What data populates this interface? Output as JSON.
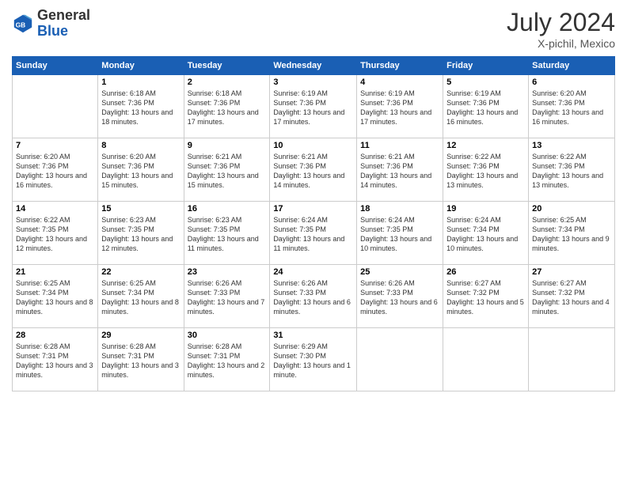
{
  "header": {
    "logo_general": "General",
    "logo_blue": "Blue",
    "month_year": "July 2024",
    "location": "X-pichil, Mexico"
  },
  "days_of_week": [
    "Sunday",
    "Monday",
    "Tuesday",
    "Wednesday",
    "Thursday",
    "Friday",
    "Saturday"
  ],
  "weeks": [
    [
      {
        "day": "",
        "empty": true
      },
      {
        "day": "1",
        "sunrise": "Sunrise: 6:18 AM",
        "sunset": "Sunset: 7:36 PM",
        "daylight": "Daylight: 13 hours and 18 minutes."
      },
      {
        "day": "2",
        "sunrise": "Sunrise: 6:18 AM",
        "sunset": "Sunset: 7:36 PM",
        "daylight": "Daylight: 13 hours and 17 minutes."
      },
      {
        "day": "3",
        "sunrise": "Sunrise: 6:19 AM",
        "sunset": "Sunset: 7:36 PM",
        "daylight": "Daylight: 13 hours and 17 minutes."
      },
      {
        "day": "4",
        "sunrise": "Sunrise: 6:19 AM",
        "sunset": "Sunset: 7:36 PM",
        "daylight": "Daylight: 13 hours and 17 minutes."
      },
      {
        "day": "5",
        "sunrise": "Sunrise: 6:19 AM",
        "sunset": "Sunset: 7:36 PM",
        "daylight": "Daylight: 13 hours and 16 minutes."
      },
      {
        "day": "6",
        "sunrise": "Sunrise: 6:20 AM",
        "sunset": "Sunset: 7:36 PM",
        "daylight": "Daylight: 13 hours and 16 minutes."
      }
    ],
    [
      {
        "day": "7",
        "sunrise": "Sunrise: 6:20 AM",
        "sunset": "Sunset: 7:36 PM",
        "daylight": "Daylight: 13 hours and 16 minutes."
      },
      {
        "day": "8",
        "sunrise": "Sunrise: 6:20 AM",
        "sunset": "Sunset: 7:36 PM",
        "daylight": "Daylight: 13 hours and 15 minutes."
      },
      {
        "day": "9",
        "sunrise": "Sunrise: 6:21 AM",
        "sunset": "Sunset: 7:36 PM",
        "daylight": "Daylight: 13 hours and 15 minutes."
      },
      {
        "day": "10",
        "sunrise": "Sunrise: 6:21 AM",
        "sunset": "Sunset: 7:36 PM",
        "daylight": "Daylight: 13 hours and 14 minutes."
      },
      {
        "day": "11",
        "sunrise": "Sunrise: 6:21 AM",
        "sunset": "Sunset: 7:36 PM",
        "daylight": "Daylight: 13 hours and 14 minutes."
      },
      {
        "day": "12",
        "sunrise": "Sunrise: 6:22 AM",
        "sunset": "Sunset: 7:36 PM",
        "daylight": "Daylight: 13 hours and 13 minutes."
      },
      {
        "day": "13",
        "sunrise": "Sunrise: 6:22 AM",
        "sunset": "Sunset: 7:36 PM",
        "daylight": "Daylight: 13 hours and 13 minutes."
      }
    ],
    [
      {
        "day": "14",
        "sunrise": "Sunrise: 6:22 AM",
        "sunset": "Sunset: 7:35 PM",
        "daylight": "Daylight: 13 hours and 12 minutes."
      },
      {
        "day": "15",
        "sunrise": "Sunrise: 6:23 AM",
        "sunset": "Sunset: 7:35 PM",
        "daylight": "Daylight: 13 hours and 12 minutes."
      },
      {
        "day": "16",
        "sunrise": "Sunrise: 6:23 AM",
        "sunset": "Sunset: 7:35 PM",
        "daylight": "Daylight: 13 hours and 11 minutes."
      },
      {
        "day": "17",
        "sunrise": "Sunrise: 6:24 AM",
        "sunset": "Sunset: 7:35 PM",
        "daylight": "Daylight: 13 hours and 11 minutes."
      },
      {
        "day": "18",
        "sunrise": "Sunrise: 6:24 AM",
        "sunset": "Sunset: 7:35 PM",
        "daylight": "Daylight: 13 hours and 10 minutes."
      },
      {
        "day": "19",
        "sunrise": "Sunrise: 6:24 AM",
        "sunset": "Sunset: 7:34 PM",
        "daylight": "Daylight: 13 hours and 10 minutes."
      },
      {
        "day": "20",
        "sunrise": "Sunrise: 6:25 AM",
        "sunset": "Sunset: 7:34 PM",
        "daylight": "Daylight: 13 hours and 9 minutes."
      }
    ],
    [
      {
        "day": "21",
        "sunrise": "Sunrise: 6:25 AM",
        "sunset": "Sunset: 7:34 PM",
        "daylight": "Daylight: 13 hours and 8 minutes."
      },
      {
        "day": "22",
        "sunrise": "Sunrise: 6:25 AM",
        "sunset": "Sunset: 7:34 PM",
        "daylight": "Daylight: 13 hours and 8 minutes."
      },
      {
        "day": "23",
        "sunrise": "Sunrise: 6:26 AM",
        "sunset": "Sunset: 7:33 PM",
        "daylight": "Daylight: 13 hours and 7 minutes."
      },
      {
        "day": "24",
        "sunrise": "Sunrise: 6:26 AM",
        "sunset": "Sunset: 7:33 PM",
        "daylight": "Daylight: 13 hours and 6 minutes."
      },
      {
        "day": "25",
        "sunrise": "Sunrise: 6:26 AM",
        "sunset": "Sunset: 7:33 PM",
        "daylight": "Daylight: 13 hours and 6 minutes."
      },
      {
        "day": "26",
        "sunrise": "Sunrise: 6:27 AM",
        "sunset": "Sunset: 7:32 PM",
        "daylight": "Daylight: 13 hours and 5 minutes."
      },
      {
        "day": "27",
        "sunrise": "Sunrise: 6:27 AM",
        "sunset": "Sunset: 7:32 PM",
        "daylight": "Daylight: 13 hours and 4 minutes."
      }
    ],
    [
      {
        "day": "28",
        "sunrise": "Sunrise: 6:28 AM",
        "sunset": "Sunset: 7:31 PM",
        "daylight": "Daylight: 13 hours and 3 minutes."
      },
      {
        "day": "29",
        "sunrise": "Sunrise: 6:28 AM",
        "sunset": "Sunset: 7:31 PM",
        "daylight": "Daylight: 13 hours and 3 minutes."
      },
      {
        "day": "30",
        "sunrise": "Sunrise: 6:28 AM",
        "sunset": "Sunset: 7:31 PM",
        "daylight": "Daylight: 13 hours and 2 minutes."
      },
      {
        "day": "31",
        "sunrise": "Sunrise: 6:29 AM",
        "sunset": "Sunset: 7:30 PM",
        "daylight": "Daylight: 13 hours and 1 minute."
      },
      {
        "day": "",
        "empty": true
      },
      {
        "day": "",
        "empty": true
      },
      {
        "day": "",
        "empty": true
      }
    ]
  ]
}
